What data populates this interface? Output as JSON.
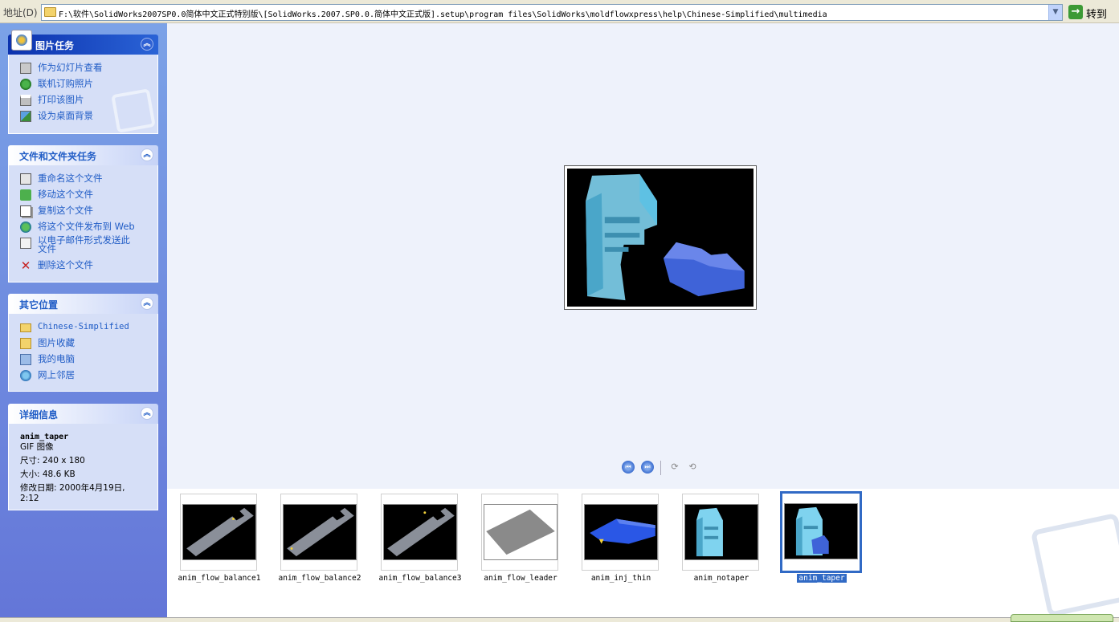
{
  "address_bar": {
    "label": "地址(D)",
    "path": "F:\\软件\\SolidWorks2007SP0.0简体中文正式特别版\\[SolidWorks.2007.SP0.0.简体中文正式版].setup\\program files\\SolidWorks\\moldflowxpress\\help\\Chinese-Simplified\\multimedia",
    "go_label": "转到"
  },
  "task_pane": {
    "picture_tasks": {
      "title": "图片任务",
      "items": [
        {
          "label": "作为幻灯片查看",
          "icon": "slideshow-icon"
        },
        {
          "label": "联机订购照片",
          "icon": "order-prints-icon"
        },
        {
          "label": "打印该图片",
          "icon": "printer-icon"
        },
        {
          "label": "设为桌面背景",
          "icon": "desktop-background-icon"
        }
      ]
    },
    "file_tasks": {
      "title": "文件和文件夹任务",
      "items": [
        {
          "label": "重命名这个文件",
          "icon": "rename-icon"
        },
        {
          "label": "移动这个文件",
          "icon": "move-icon"
        },
        {
          "label": "复制这个文件",
          "icon": "copy-icon"
        },
        {
          "label": "将这个文件发布到 Web",
          "icon": "publish-web-icon"
        },
        {
          "label": "以电子邮件形式发送此文件",
          "icon": "email-icon"
        },
        {
          "label": "删除这个文件",
          "icon": "delete-icon"
        }
      ]
    },
    "other_places": {
      "title": "其它位置",
      "items": [
        {
          "label": "Chinese-Simplified",
          "icon": "folder-icon"
        },
        {
          "label": "图片收藏",
          "icon": "my-pictures-icon"
        },
        {
          "label": "我的电脑",
          "icon": "my-computer-icon"
        },
        {
          "label": "网上邻居",
          "icon": "network-places-icon"
        }
      ]
    },
    "details": {
      "title": "详细信息",
      "file_name": "anim_taper",
      "file_type": "GIF 图像",
      "dimensions": "尺寸: 240 x 180",
      "size": "大小: 48.6 KB",
      "modified": "修改日期: 2000年4月19日, 2:12"
    }
  },
  "filmstrip": {
    "items": [
      {
        "label": "anim_flow_balance1",
        "kind": "slab"
      },
      {
        "label": "anim_flow_balance2",
        "kind": "slab"
      },
      {
        "label": "anim_flow_balance3",
        "kind": "slab"
      },
      {
        "label": "anim_flow_leader",
        "kind": "plate"
      },
      {
        "label": "anim_inj_thin",
        "kind": "thin"
      },
      {
        "label": "anim_notaper",
        "kind": "mold"
      },
      {
        "label": "anim_taper",
        "kind": "mold",
        "selected": true
      }
    ]
  },
  "colors": {
    "accent": "#316ac5",
    "link": "#215dc6",
    "pane_top": "#7ba2e7",
    "pane_bottom": "#6476d8"
  }
}
